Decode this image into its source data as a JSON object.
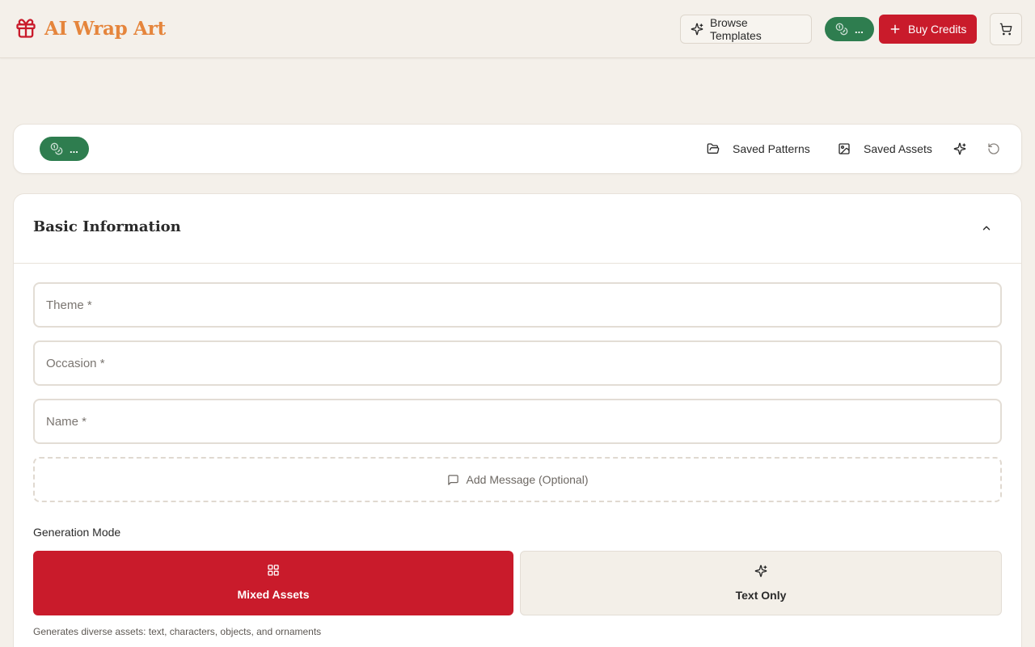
{
  "brand": {
    "name": "AI Wrap Art",
    "logo_color": "#c91b2b",
    "text_color": "#e5853c"
  },
  "header": {
    "browse_templates_label": "Browse Templates",
    "credits_badge": "...",
    "buy_credits_label": "Buy Credits",
    "cart_icon": "cart-icon"
  },
  "toolbar": {
    "credits_badge": "...",
    "saved_patterns_label": "Saved Patterns",
    "saved_assets_label": "Saved Assets",
    "icons": [
      "folder-open-icon",
      "image-icon",
      "sparkles-icon",
      "reset-icon"
    ]
  },
  "form": {
    "section_title": "Basic Information",
    "theme_placeholder": "Theme *",
    "occasion_placeholder": "Occasion *",
    "name_placeholder": "Name *",
    "add_message_label": "Add Message (Optional)",
    "generation_mode_label": "Generation Mode",
    "modes": [
      {
        "label": "Mixed Assets",
        "icon": "grid-icon",
        "selected": true
      },
      {
        "label": "Text Only",
        "icon": "sparkles-icon",
        "selected": false
      }
    ],
    "mode_hint": "Generates diverse assets: text, characters, objects, and ornaments"
  },
  "colors": {
    "primary_red": "#c91b2b",
    "credits_green": "#2e7d4f",
    "background": "#f4f0ea"
  }
}
